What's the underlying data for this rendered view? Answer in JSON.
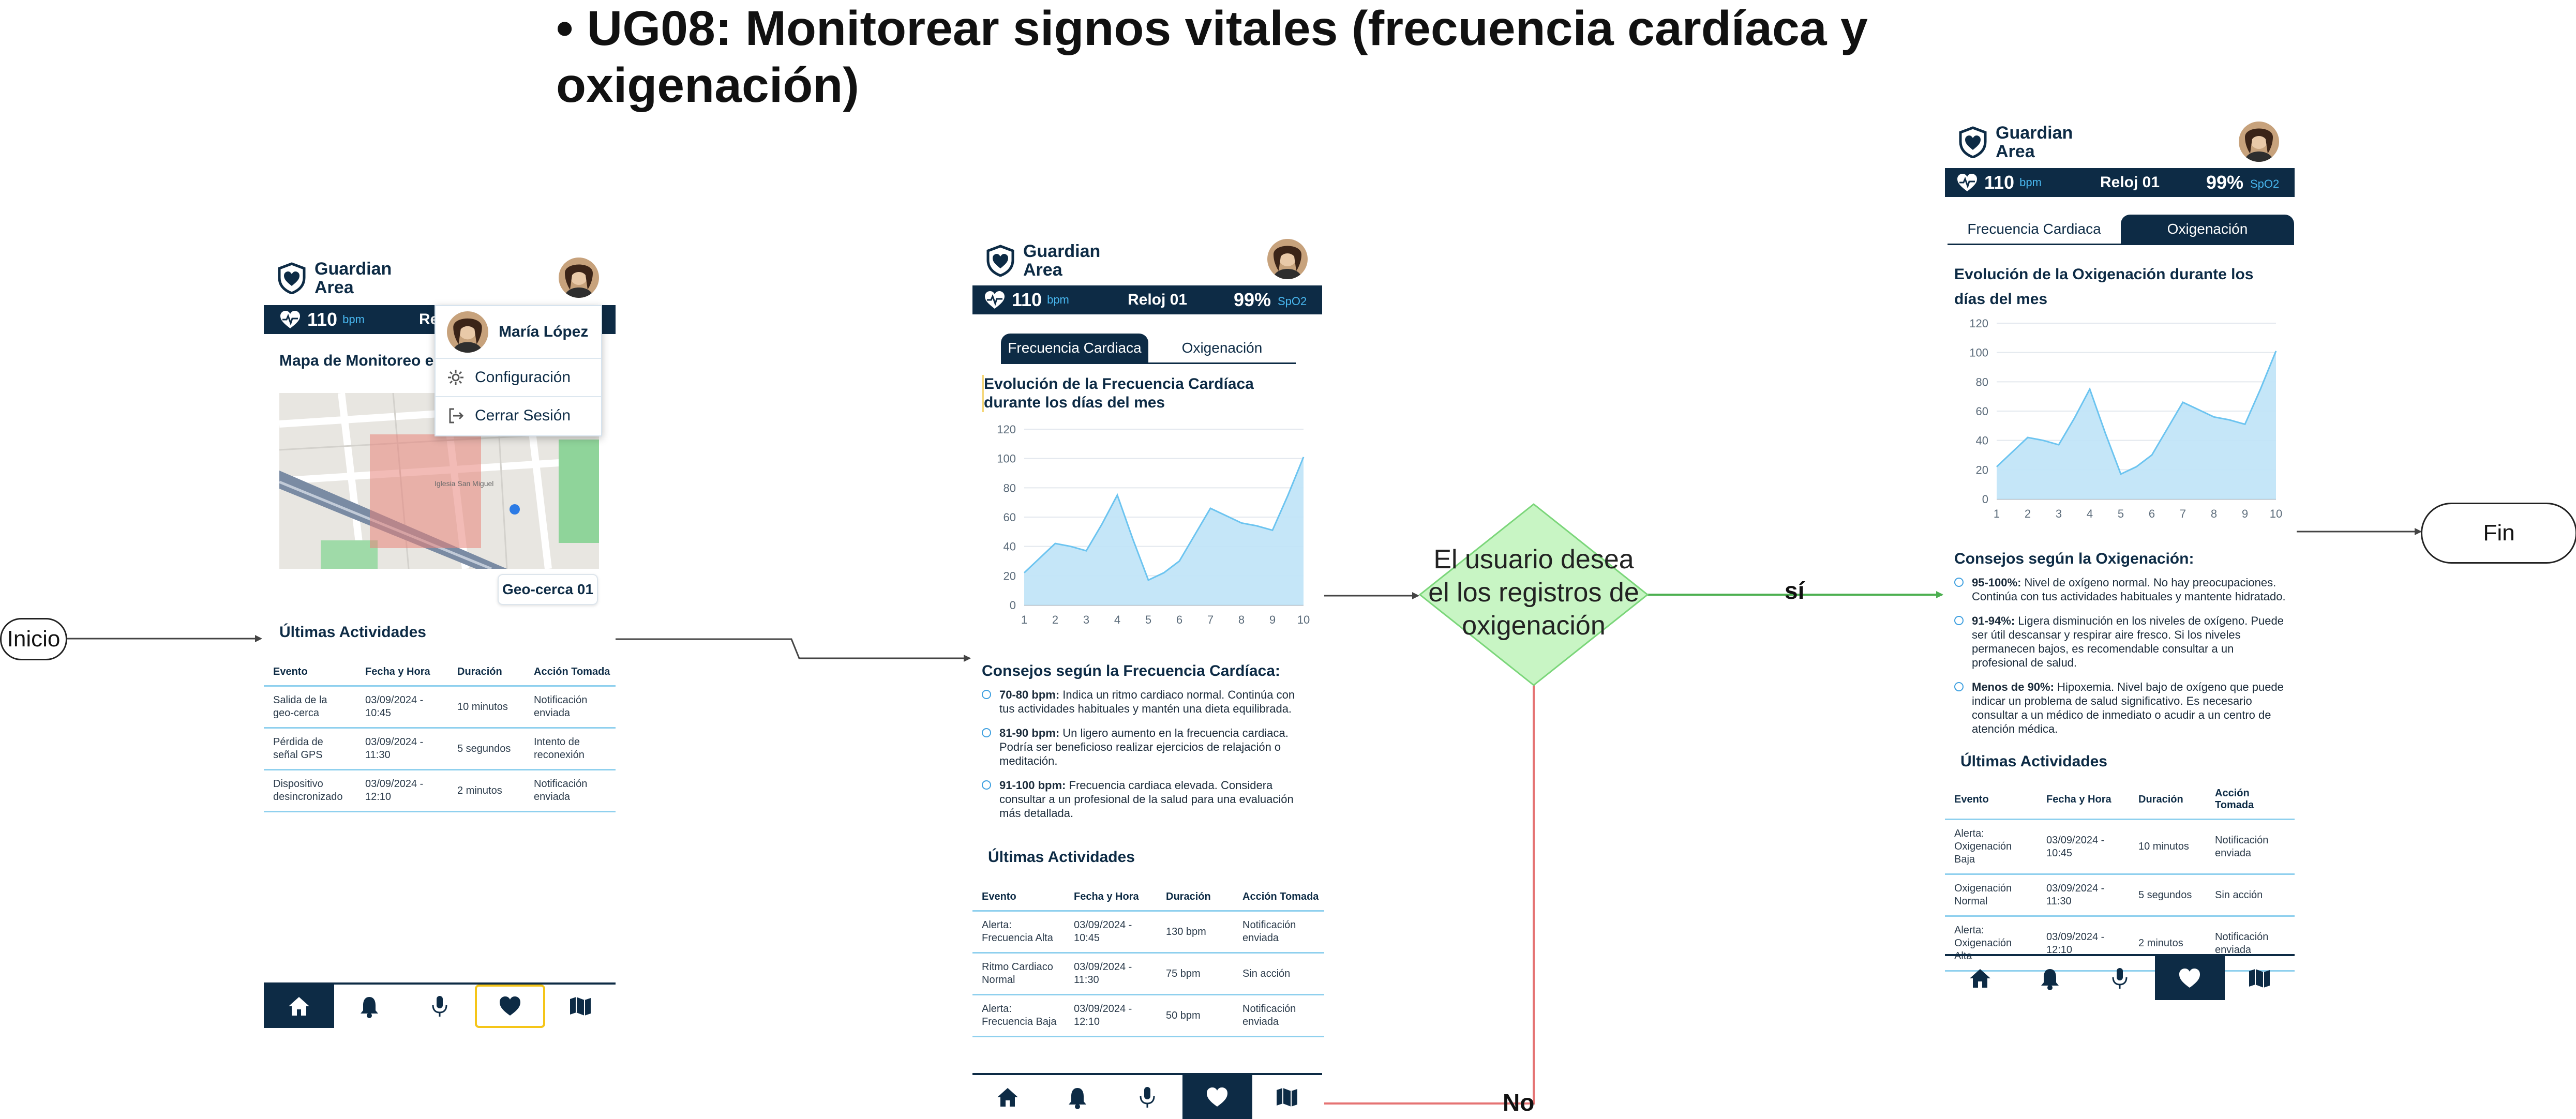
{
  "title": "• UG08: Monitorear signos vitales (frecuencia cardíaca y oxigenación)",
  "flow": {
    "start_label": "Inicio",
    "end_label": "Fin",
    "decision_text": "El usuario desea el los registros de oxigenación",
    "yes_label": "sí",
    "no_label": "No",
    "colors": {
      "yes": "#4caf50",
      "no": "#e57373",
      "decision_fill": "#c8f5c4",
      "decision_stroke": "#7bd67a",
      "arrow": "#444444"
    }
  },
  "app": {
    "brand_line1": "Guardian",
    "brand_line2": "Area",
    "bpm_value": "110",
    "bpm_unit": "bpm",
    "device": "Reloj 01",
    "spo2_value": "99%",
    "spo2_unit": "SpO2",
    "device_truncated": "Re",
    "colors": {
      "navy": "#0d2b45",
      "accent": "#49b8f0",
      "highlight": "#f5c518"
    }
  },
  "screen1": {
    "map_title": "Mapa de Monitoreo en",
    "geofence_button": "Geo-cerca 01",
    "map_place_label": "Iglesia San Miguel",
    "popup": {
      "user_name": "María López",
      "settings": "Configuración",
      "logout": "Cerrar Sesión"
    },
    "activities_title": "Últimas Actividades",
    "table": {
      "headers": [
        "Evento",
        "Fecha y Hora",
        "Duración",
        "Acción Tomada"
      ],
      "rows": [
        [
          "Salida de la geo-cerca",
          "03/09/2024 - 10:45",
          "10 minutos",
          "Notificación enviada"
        ],
        [
          "Pérdida de señal GPS",
          "03/09/2024 - 11:30",
          "5 segundos",
          "Intento de reconexión"
        ],
        [
          "Dispositivo desincronizado",
          "03/09/2024 - 12:10",
          "2 minutos",
          "Notificación enviada"
        ]
      ]
    },
    "nav_active": "heart-icon"
  },
  "screen2": {
    "tab_heart": "Frecuencia Cardiaca",
    "tab_oxygen": "Oxigenación",
    "active_tab": "Frecuencia Cardiaca",
    "chart_title": "Evolución de la Frecuencia Cardíaca durante los días del mes",
    "advice_title": "Consejos según la Frecuencia Cardíaca:",
    "advice": [
      {
        "range": "70-80 bpm:",
        "text": " Indica un ritmo cardiaco normal. Continúa con tus actividades habituales y mantén una dieta equilibrada."
      },
      {
        "range": "81-90 bpm:",
        "text": " Un ligero aumento en la frecuencia cardiaca. Podría ser beneficioso realizar ejercicios de relajación o meditación."
      },
      {
        "range": "91-100 bpm:",
        "text": " Frecuencia cardiaca elevada. Considera consultar a un profesional de la salud para una evaluación más detallada."
      }
    ],
    "activities_title": "Últimas Actividades",
    "table": {
      "headers": [
        "Evento",
        "Fecha y Hora",
        "Duración",
        "Acción Tomada"
      ],
      "rows": [
        [
          "Alerta: Frecuencia Alta",
          "03/09/2024 - 10:45",
          "130 bpm",
          "Notificación enviada"
        ],
        [
          "Ritmo Cardiaco Normal",
          "03/09/2024 - 11:30",
          "75 bpm",
          "Sin acción"
        ],
        [
          "Alerta: Frecuencia Baja",
          "03/09/2024 - 12:10",
          "50 bpm",
          "Notificación enviada"
        ]
      ]
    }
  },
  "screen3": {
    "tab_heart": "Frecuencia Cardiaca",
    "tab_oxygen": "Oxigenación",
    "active_tab": "Oxigenación",
    "chart_title": "Evolución de la Oxigenación durante los días del mes",
    "advice_title": "Consejos según la Oxigenación:",
    "advice": [
      {
        "range": "95-100%:",
        "text": " Nivel de oxígeno normal. No hay preocupaciones. Continúa con tus actividades habituales y mantente hidratado."
      },
      {
        "range": "91-94%:",
        "text": " Ligera disminución en los niveles de oxígeno. Puede ser útil descansar y respirar aire fresco. Si los niveles permanecen bajos, es recomendable consultar a un profesional de salud."
      },
      {
        "range": "Menos de 90%:",
        "text": " Hipoxemia. Nivel bajo de oxígeno que puede indicar un problema de salud significativo. Es necesario consultar a un médico de inmediato o acudir a un centro de atención médica."
      }
    ],
    "activities_title": "Últimas Actividades",
    "table": {
      "headers": [
        "Evento",
        "Fecha y Hora",
        "Duración",
        "Acción Tomada"
      ],
      "rows": [
        [
          "Alerta: Oxigenación Baja",
          "03/09/2024 - 10:45",
          "10 minutos",
          "Notificación enviada"
        ],
        [
          "Oxigenación Normal",
          "03/09/2024 - 11:30",
          "5 segundos",
          "Sin acción"
        ],
        [
          "Alerta: Oxigenación Alta",
          "03/09/2024 - 12:10",
          "2 minutos",
          "Notificación enviada"
        ]
      ]
    }
  },
  "chart_data": [
    {
      "type": "area",
      "x": [
        1,
        1.5,
        2,
        2.5,
        3,
        3.5,
        4,
        4.5,
        5,
        5.5,
        6,
        6.5,
        7,
        7.5,
        8,
        8.5,
        9,
        9.5,
        10
      ],
      "series": [
        {
          "values": [
            22,
            32,
            42,
            40,
            37,
            55,
            75,
            45,
            17,
            22,
            30,
            48,
            66,
            61,
            56,
            54,
            51,
            75,
            101
          ]
        }
      ],
      "xticks": [
        "1",
        "2",
        "3",
        "4",
        "5",
        "6",
        "7",
        "8",
        "9",
        "10"
      ],
      "yticks": [
        "0",
        "20",
        "40",
        "60",
        "80",
        "100",
        "120"
      ],
      "xlim": [
        1,
        10
      ],
      "ylim": [
        0,
        120
      ],
      "color": "#6cc4f0"
    },
    {
      "type": "area",
      "x": [
        1,
        1.5,
        2,
        2.5,
        3,
        3.5,
        4,
        4.5,
        5,
        5.5,
        6,
        6.5,
        7,
        7.5,
        8,
        8.5,
        9,
        9.5,
        10
      ],
      "series": [
        {
          "values": [
            22,
            32,
            42,
            40,
            37,
            55,
            75,
            45,
            17,
            22,
            30,
            48,
            66,
            61,
            56,
            54,
            51,
            75,
            101
          ]
        }
      ],
      "xticks": [
        "1",
        "2",
        "3",
        "4",
        "5",
        "6",
        "7",
        "8",
        "9",
        "10"
      ],
      "yticks": [
        "0",
        "20",
        "40",
        "60",
        "80",
        "100",
        "120"
      ],
      "xlim": [
        1,
        10
      ],
      "ylim": [
        0,
        120
      ],
      "color": "#6cc4f0"
    }
  ]
}
